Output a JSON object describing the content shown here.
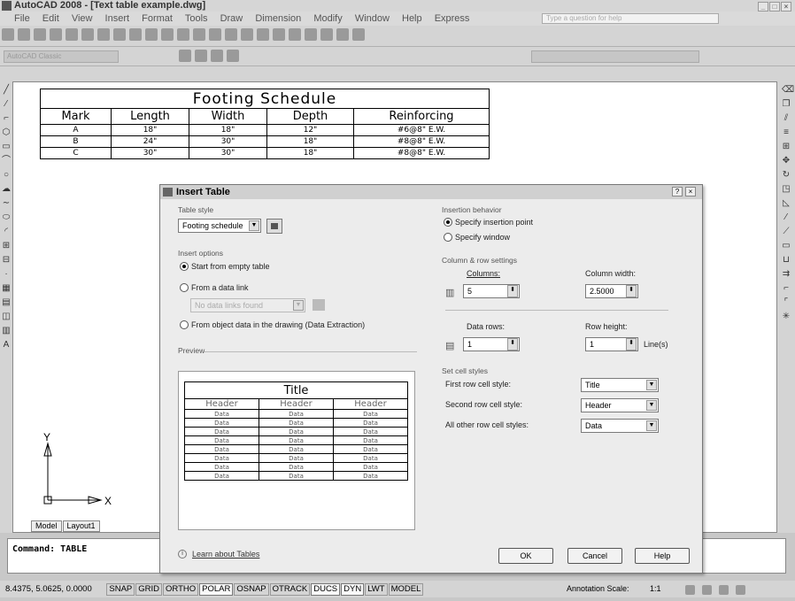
{
  "window": {
    "title": "AutoCAD 2008 - [Text table example.dwg]",
    "help_placeholder": "Type a question for help"
  },
  "menu": [
    "File",
    "Edit",
    "View",
    "Insert",
    "Format",
    "Tools",
    "Draw",
    "Dimension",
    "Modify",
    "Window",
    "Help",
    "Express"
  ],
  "toolbar": {
    "workspace": "AutoCAD Classic"
  },
  "footing_table": {
    "title": "Footing Schedule",
    "headers": [
      "Mark",
      "Length",
      "Width",
      "Depth",
      "Reinforcing"
    ],
    "rows": [
      [
        "A",
        "18\"",
        "18\"",
        "12\"",
        "#6@8\" E.W."
      ],
      [
        "B",
        "24\"",
        "30\"",
        "18\"",
        "#8@8\" E.W."
      ],
      [
        "C",
        "30\"",
        "30\"",
        "18\"",
        "#8@8\" E.W."
      ]
    ]
  },
  "axes": {
    "y": "Y",
    "x": "X"
  },
  "layout_tabs": [
    "Model",
    "Layout1"
  ],
  "command": {
    "prompt": "Command: TABLE"
  },
  "statusbar": {
    "coords": "8.4375, 5.0625, 0.0000",
    "toggles": [
      "SNAP",
      "GRID",
      "ORTHO",
      "POLAR",
      "OSNAP",
      "OTRACK",
      "DUCS",
      "DYN",
      "LWT",
      "MODEL"
    ],
    "annotation_scale_label": "Annotation Scale:",
    "annotation_scale_value": "1:1"
  },
  "dialog": {
    "title": "Insert Table",
    "table_style_label": "Table style",
    "table_style_value": "Footing schedule",
    "insert_options_label": "Insert options",
    "opt_empty": "Start from empty table",
    "opt_link": "From a data link",
    "opt_link_placeholder": "No data links found",
    "opt_object": "From object data in the drawing (Data Extraction)",
    "preview_label": "Preview",
    "preview": {
      "title": "Title",
      "headers": [
        "Header",
        "Header",
        "Header"
      ],
      "data_label": "Data",
      "data_rows": 8
    },
    "insertion_behavior_label": "Insertion behavior",
    "insertion_point": "Specify insertion point",
    "insertion_window": "Specify window",
    "colrow_label": "Column & row settings",
    "columns_label": "Columns:",
    "columns_value": "5",
    "column_width_label": "Column width:",
    "column_width_value": "2.5000",
    "data_rows_label": "Data rows:",
    "data_rows_value": "1",
    "row_height_label": "Row height:",
    "row_height_value": "1",
    "row_height_unit": "Line(s)",
    "cell_styles_label": "Set cell styles",
    "first_row_label": "First row cell style:",
    "first_row_value": "Title",
    "second_row_label": "Second row cell style:",
    "second_row_value": "Header",
    "other_rows_label": "All other row cell styles:",
    "other_rows_value": "Data",
    "learn_link": "Learn about Tables",
    "ok": "OK",
    "cancel": "Cancel",
    "help": "Help"
  }
}
